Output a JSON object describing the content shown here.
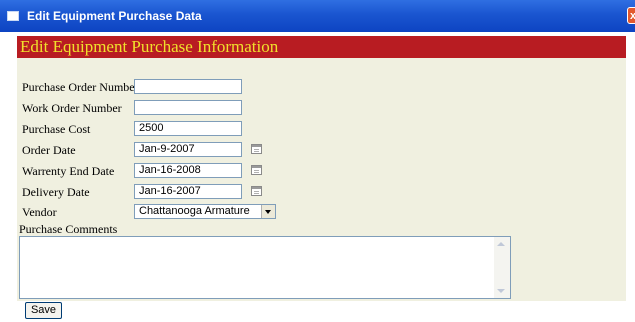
{
  "window": {
    "title": "Edit Equipment Purchase Data",
    "close_glyph": "x"
  },
  "form": {
    "heading": "Edit Equipment Purchase Information",
    "fields": [
      {
        "label": "Purchase Order Number",
        "value": ""
      },
      {
        "label": "Work Order Number",
        "value": ""
      },
      {
        "label": "Purchase Cost",
        "value": "2500"
      },
      {
        "label": "Order Date",
        "value": "Jan-9-2007"
      },
      {
        "label": "Warrenty End Date",
        "value": "Jan-16-2008"
      },
      {
        "label": "Delivery Date",
        "value": "Jan-16-2007"
      }
    ],
    "vendor": {
      "label": "Vendor",
      "selected": "Chattanooga Armature"
    },
    "comments": {
      "label": "Purchase Comments",
      "value": ""
    },
    "save_label": "Save"
  },
  "colors": {
    "titlebar": "#0d44c2",
    "header_bg": "#b81c22",
    "header_text": "#f0e02c",
    "panel_bg": "#f0f0e0"
  },
  "icons": [
    "window-icon",
    "close-icon",
    "calendar-icon",
    "dropdown-arrow-icon",
    "scroll-up-icon",
    "scroll-down-icon"
  ]
}
